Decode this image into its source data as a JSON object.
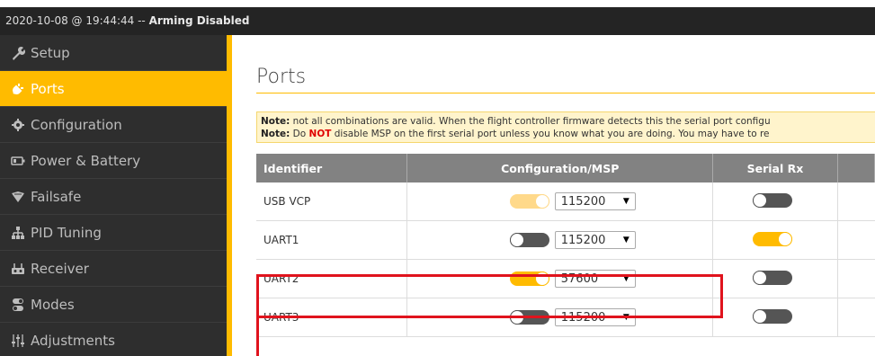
{
  "status": {
    "timestamp": "2020-10-08 @ 19:44:44 --",
    "arming": "Arming Disabled"
  },
  "sidebar": {
    "items": [
      {
        "label": "Setup",
        "icon": "wrench-icon",
        "active": false
      },
      {
        "label": "Ports",
        "icon": "plug-icon",
        "active": true
      },
      {
        "label": "Configuration",
        "icon": "gear-icon",
        "active": false
      },
      {
        "label": "Power & Battery",
        "icon": "battery-icon",
        "active": false
      },
      {
        "label": "Failsafe",
        "icon": "shield-icon",
        "active": false
      },
      {
        "label": "PID Tuning",
        "icon": "tuning-icon",
        "active": false
      },
      {
        "label": "Receiver",
        "icon": "receiver-icon",
        "active": false
      },
      {
        "label": "Modes",
        "icon": "modes-icon",
        "active": false
      },
      {
        "label": "Adjustments",
        "icon": "sliders-icon",
        "active": false
      }
    ]
  },
  "main": {
    "title": "Ports",
    "note1_label": "Note:",
    "note1_text": " not all combinations are valid. When the flight controller firmware detects this the serial port configu",
    "note2_label": "Note:",
    "note2_pre": " Do ",
    "note2_not": "NOT",
    "note2_post": " disable MSP on the first serial port unless you know what you are doing. You may have to re"
  },
  "table": {
    "headers": {
      "identifier": "Identifier",
      "config_msp": "Configuration/MSP",
      "serial_rx": "Serial Rx"
    },
    "rows": [
      {
        "id": "USB VCP",
        "msp_on": true,
        "msp_light": true,
        "baud": "115200",
        "rx_on": false
      },
      {
        "id": "UART1",
        "msp_on": false,
        "baud": "115200",
        "rx_on": true
      },
      {
        "id": "UART2",
        "msp_on": true,
        "baud": "57600",
        "rx_on": false
      },
      {
        "id": "UART3",
        "msp_on": false,
        "baud": "115200",
        "rx_on": false
      }
    ]
  },
  "colors": {
    "accent": "#ffbb00",
    "highlight": "#e0131d",
    "sidebar_bg": "#2e2e2e",
    "header_bg": "#828282"
  }
}
